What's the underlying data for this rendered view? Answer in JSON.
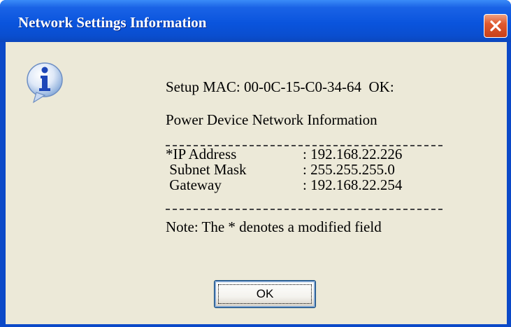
{
  "window": {
    "title": "Network Settings Information",
    "close_icon": "close-x-icon"
  },
  "dialog": {
    "icon": "info-icon",
    "setup_line": "Setup MAC: 00-0C-15-C0-34-64  OK:",
    "section_heading": "Power Device Network Information",
    "fields": [
      {
        "label": "*IP Address",
        "value": ": 192.168.22.226"
      },
      {
        "label": " Subnet Mask",
        "value": ": 255.255.255.0"
      },
      {
        "label": " Gateway",
        "value": ": 192.168.22.254"
      }
    ],
    "note": "Note: The * denotes a modified field"
  },
  "buttons": {
    "ok_label": "OK"
  },
  "colors": {
    "title_bar": "#0a54dd",
    "dialog_bg": "#ece9d8",
    "close_red": "#e05a30"
  }
}
